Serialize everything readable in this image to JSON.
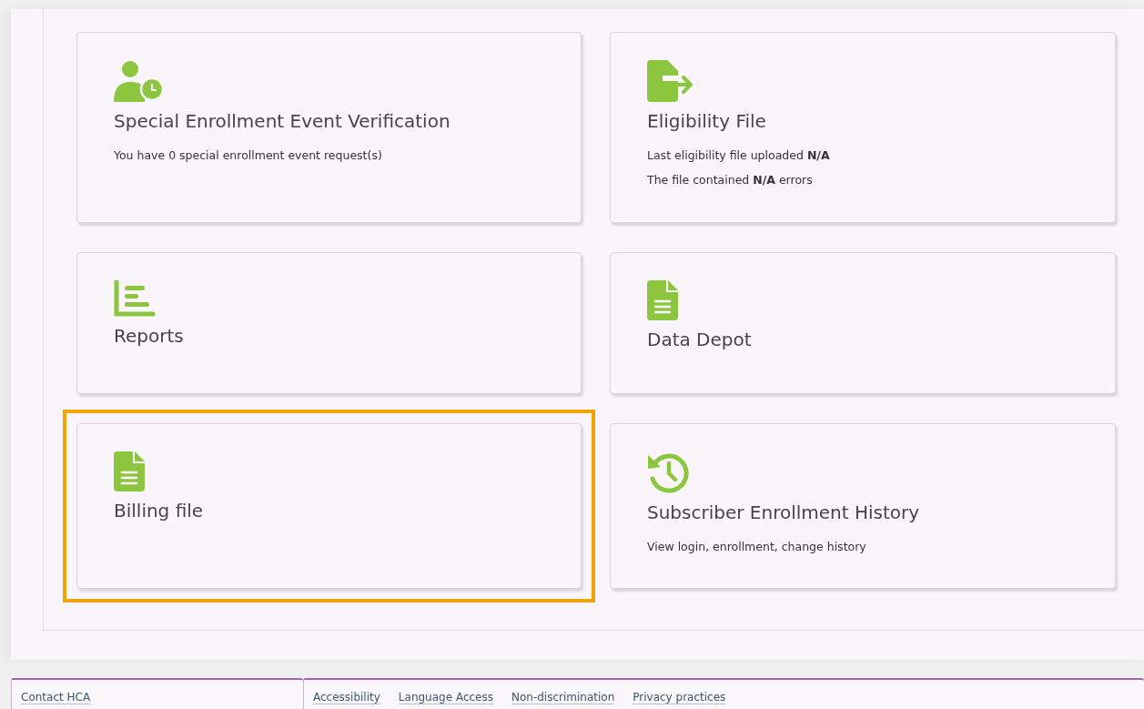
{
  "cards": [
    {
      "kind": "person-clock",
      "title": "Special Enrollment Event Verification",
      "lines": [
        "You have 0 special enrollment event request(s)"
      ],
      "highlighted": false
    },
    {
      "kind": "export",
      "title": "Eligibility File",
      "lines": [
        "Last eligibility file uploaded **N/A**",
        "The file contained **N/A** errors"
      ],
      "highlighted": false
    },
    {
      "kind": "chart",
      "title": "Reports",
      "highlighted": false
    },
    {
      "kind": "document",
      "title": "Data Depot",
      "highlighted": false
    },
    {
      "kind": "document",
      "title": "Billing file",
      "highlighted": true
    },
    {
      "kind": "history",
      "title": "Subscriber Enrollment History",
      "lines": [
        "View login, enrollment, change history"
      ],
      "highlighted": false
    }
  ],
  "footer": {
    "tabs": [
      {
        "links": [
          "Contact HCA"
        ]
      },
      {
        "links": [
          "Accessibility",
          "Language Access",
          "Non-discrimination",
          "Privacy practices"
        ]
      }
    ]
  }
}
